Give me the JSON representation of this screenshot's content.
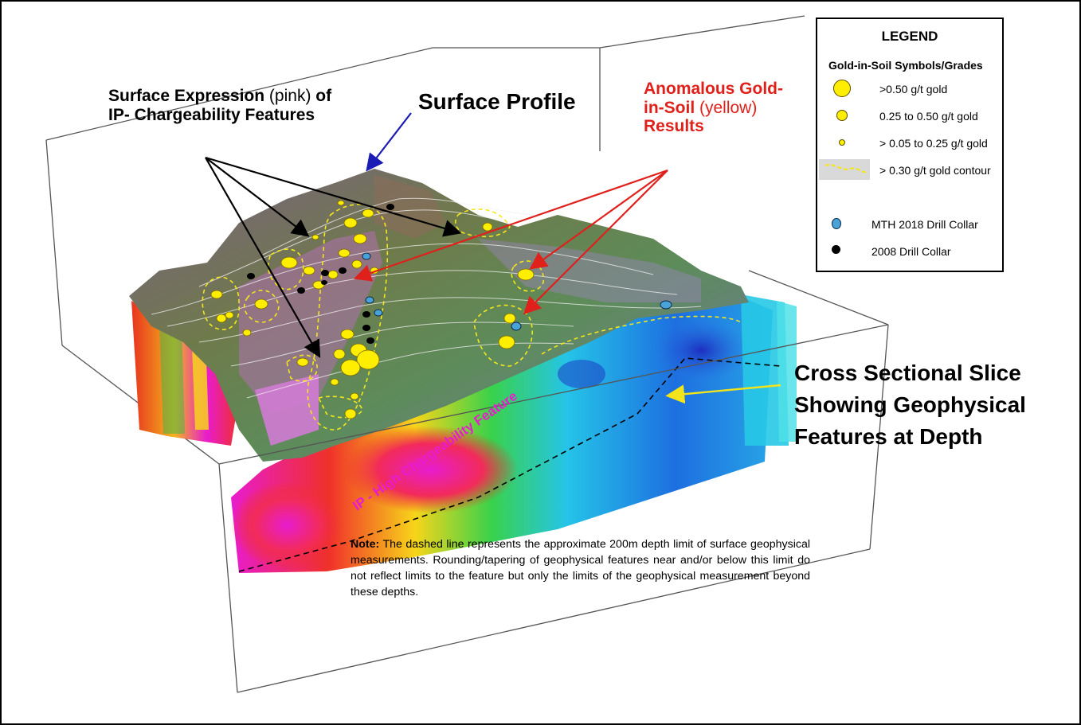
{
  "annotations": {
    "surface_expression": {
      "line1_a": "Surface Expression ",
      "line1_b": "(pink)",
      "line1_c": " of",
      "line2": "IP- Chargeability Features"
    },
    "surface_profile": "Surface Profile",
    "anomalous": {
      "line1": "Anomalous Gold-",
      "line2_a": "in-Soil ",
      "line2_b": "(yellow)",
      "line3": "Results"
    },
    "cross_section": {
      "line1": "Cross Sectional Slice",
      "line2": "Showing Geophysical",
      "line3": "Features at Depth"
    },
    "ip_feature": "IP - High Chargeability Feature"
  },
  "legend": {
    "title": "LEGEND",
    "subtitle": "Gold-in-Soil Symbols/Grades",
    "items": [
      {
        "label": ">0.50 g/t gold",
        "icon": "large-yellow-circle-icon",
        "color": "#ffee00"
      },
      {
        "label": "0.25 to 0.50 g/t gold",
        "icon": "medium-yellow-circle-icon",
        "color": "#ffee00"
      },
      {
        "label": "> 0.05 to 0.25 g/t gold",
        "icon": "small-yellow-circle-icon",
        "color": "#ffee00"
      },
      {
        "label": "> 0.30 g/t gold contour",
        "icon": "dashed-yellow-contour-icon",
        "color": "#f3e61b"
      },
      {
        "label": "MTH 2018 Drill Collar",
        "icon": "blue-dot-icon",
        "color": "#4aa3d8"
      },
      {
        "label": "2008 Drill Collar",
        "icon": "black-dot-icon",
        "color": "#000000"
      }
    ]
  },
  "note": {
    "label": "Note:",
    "text": " The dashed line represents the approximate 200m depth limit of surface geophysical measurements. Rounding/tapering of geophysical features near and/or below this limit do not reflect limits to the feature but only the limits of the geophysical measurement beyond these depths."
  },
  "colors": {
    "anomaly_red": "#e0201b",
    "gold_yellow": "#ffee00",
    "arrow_blue": "#1b1bb5",
    "arrow_yellow": "#f2e31a",
    "high_chargeability": "#e81ccf"
  }
}
